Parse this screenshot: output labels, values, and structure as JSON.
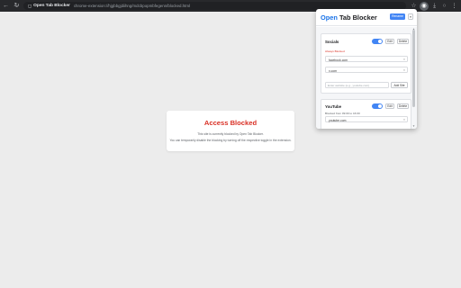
{
  "browser": {
    "site_icon": "◻",
    "site_name": "Open Tab Blocker",
    "url": "chrome-extension://hjgbbgjdiihng/mdcbpopmbfegenn/blocked.html",
    "nav": {
      "back": "←",
      "forward": "→",
      "reload": "↻"
    },
    "right_icons": {
      "star": "☆",
      "extension": "◉",
      "download": "⤓",
      "profile": "○",
      "menu": "⋮"
    }
  },
  "blocked_page": {
    "title": "Access Blocked",
    "message": "This site is currently blocked by Open Tab Blocker.",
    "hint": "You can temporarily disable the blocking by turning off the respective toggle in the extension."
  },
  "popup": {
    "logo_accent": "Open",
    "logo_rest": " Tab Blocker",
    "rename_label": "Rename",
    "menu_label": "▾",
    "groups": [
      {
        "name": "Socials",
        "enabled": true,
        "edit_label": "Edit",
        "delete_label": "Delete",
        "section_label": "Always Blocked",
        "sites": [
          {
            "text": "facebook.com",
            "remove": "×"
          },
          {
            "text": "x.com",
            "remove": "×"
          }
        ],
        "add_placeholder": "Enter website (e.g., youtube.com)",
        "add_label": "Add Site"
      },
      {
        "name": "YouTube",
        "enabled": true,
        "edit_label": "Edit",
        "delete_label": "Delete",
        "schedule": "Blocked from 09:00 to 16:00",
        "sites": [
          {
            "text": "youtube.com",
            "remove": "×"
          }
        ]
      }
    ]
  },
  "colors": {
    "accent": "#4285f4",
    "blocked_red": "#d93025",
    "toolbar": "#28292c"
  }
}
